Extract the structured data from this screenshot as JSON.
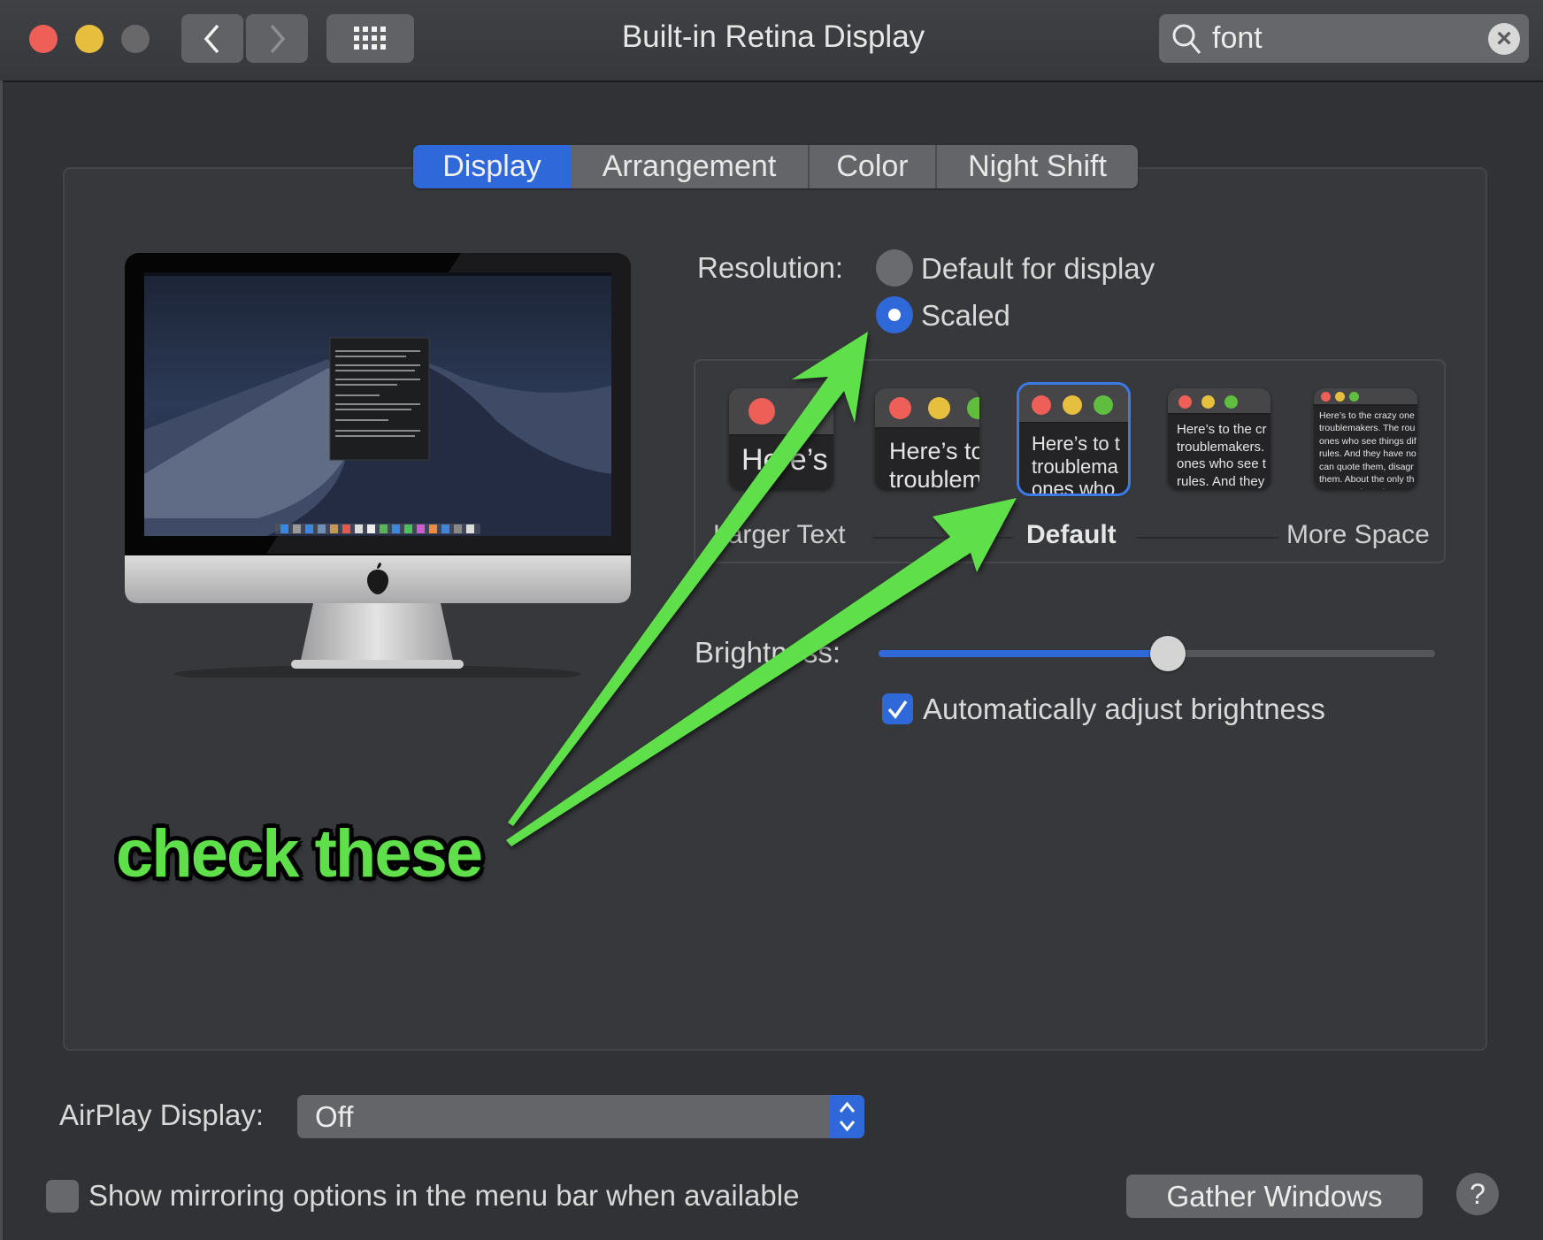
{
  "window": {
    "title": "Built-in Retina Display",
    "traffic_lights": {
      "close": "#ed5f57",
      "minimize": "#e7bf3f",
      "zoom": "#68686b"
    },
    "nav": {
      "back_icon": "chevron-left-icon",
      "forward_icon": "chevron-right-icon",
      "grid_icon": "show-all-grid-icon"
    },
    "search": {
      "value": "font",
      "icon": "search-icon",
      "clear_icon": "clear-icon"
    }
  },
  "tabs": [
    {
      "label": "Display",
      "active": true
    },
    {
      "label": "Arrangement",
      "active": false
    },
    {
      "label": "Color",
      "active": false
    },
    {
      "label": "Night Shift",
      "active": false
    }
  ],
  "resolution": {
    "label": "Resolution:",
    "options": [
      {
        "label": "Default for display",
        "selected": false
      },
      {
        "label": "Scaled",
        "selected": true
      }
    ]
  },
  "scaling": {
    "thumbnails": [
      {
        "text": "Here’s",
        "selected": false
      },
      {
        "text": "Here’s to\ntroublem",
        "selected": false
      },
      {
        "text": "Here’s to t\ntroublema\nones who",
        "selected": true
      },
      {
        "text": "Here’s to the cr\ntroublemakers.\nones who see t\nrules. And they",
        "selected": false
      },
      {
        "text": "Here’s to the crazy one\ntroublemakers. The rou\nones who see things dif\nrules. And they have no\ncan quote them, disagr\nthem. About the only th\nBecause they change th",
        "selected": false
      }
    ],
    "labels": {
      "left": "Larger Text",
      "center": "Default",
      "right": "More Space"
    }
  },
  "brightness": {
    "label": "Brightness:",
    "value_fraction": 0.52,
    "auto_label": "Automatically adjust brightness",
    "auto_checked": true
  },
  "airplay": {
    "label": "AirPlay Display:",
    "value": "Off"
  },
  "mirroring": {
    "label": "Show mirroring options in the menu bar when available",
    "checked": false
  },
  "buttons": {
    "gather": "Gather Windows",
    "help": "?"
  },
  "annotation": {
    "text": "check these",
    "color": "#5fe04a"
  },
  "colors": {
    "accent": "#2f68d8",
    "background": "#313235"
  }
}
